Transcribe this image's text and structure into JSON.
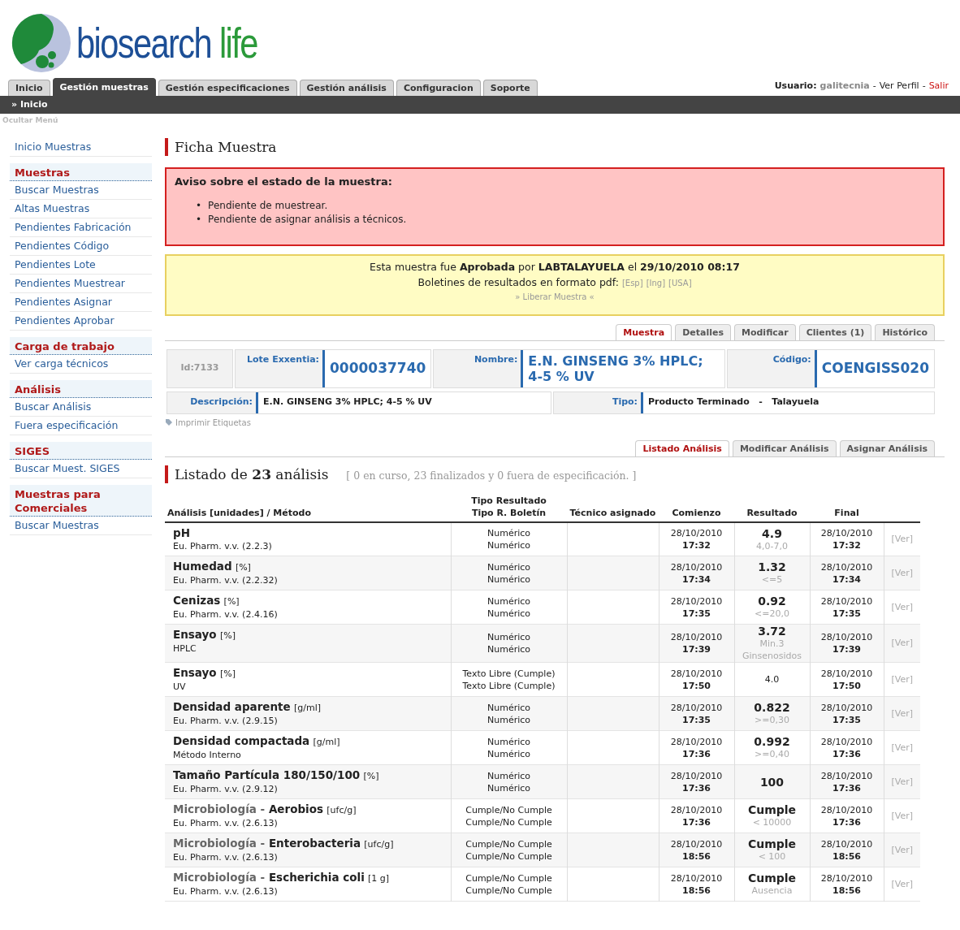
{
  "logo": {
    "word_1": "biosearch",
    "word_2": "life"
  },
  "main_tabs": [
    {
      "label": "Inicio",
      "selected": false
    },
    {
      "label": "Gestión muestras",
      "selected": true
    },
    {
      "label": "Gestión especificaciones",
      "selected": false
    },
    {
      "label": "Gestión análisis",
      "selected": false
    },
    {
      "label": "Configuracion",
      "selected": false
    },
    {
      "label": "Soporte",
      "selected": false
    }
  ],
  "user_bar": {
    "label": "Usuario:",
    "user": "galitecnia",
    "separator_1": "-",
    "profile": "Ver Perfil",
    "separator_2": "-",
    "logout": "Salir"
  },
  "breadcrumb": "» Inicio",
  "hide_menu": "Ocultar Menú",
  "sidebar": [
    {
      "kind": "link",
      "label": "Inicio Muestras"
    },
    {
      "kind": "heading",
      "label": "Muestras"
    },
    {
      "kind": "link",
      "label": "Buscar Muestras"
    },
    {
      "kind": "link",
      "label": "Altas Muestras"
    },
    {
      "kind": "link",
      "label": "Pendientes Fabricación"
    },
    {
      "kind": "link",
      "label": "Pendientes Código"
    },
    {
      "kind": "link",
      "label": "Pendientes Lote"
    },
    {
      "kind": "link",
      "label": "Pendientes Muestrear"
    },
    {
      "kind": "link",
      "label": "Pendientes Asignar"
    },
    {
      "kind": "link",
      "label": "Pendientes Aprobar"
    },
    {
      "kind": "heading",
      "label": "Carga de trabajo"
    },
    {
      "kind": "link",
      "label": "Ver carga técnicos"
    },
    {
      "kind": "heading",
      "label": "Análisis"
    },
    {
      "kind": "link",
      "label": "Buscar Análisis"
    },
    {
      "kind": "link",
      "label": "Fuera especificación"
    },
    {
      "kind": "heading",
      "label": "SIGES"
    },
    {
      "kind": "link",
      "label": "Buscar Muest. SIGES"
    },
    {
      "kind": "heading",
      "label": "Muestras para Comerciales"
    },
    {
      "kind": "link",
      "label": "Buscar Muestras"
    }
  ],
  "page_title": "Ficha Muestra",
  "warning": {
    "title": "Aviso sobre el estado de la muestra:",
    "bullet": "•",
    "items": [
      "Pendiente de muestrear.",
      "Pendiente de asignar análisis a técnicos."
    ]
  },
  "approval": {
    "text": "Esta muestra fue **Aprobada** por **LABTALAYUELA** el **29/10/2010 08:17**",
    "reports_label": "Boletines de resultados en formato pdf:",
    "reports": [
      "[Esp]",
      "[Ing]",
      "[USA]"
    ],
    "release": "» Liberar Muestra «"
  },
  "sample_tabs": [
    {
      "label": "Muestra",
      "selected": true
    },
    {
      "label": "Detalles",
      "selected": false
    },
    {
      "label": "Modificar",
      "selected": false
    },
    {
      "label": "Clientes (1)",
      "selected": false
    },
    {
      "label": "Histórico",
      "selected": false
    }
  ],
  "sample": {
    "id": "Id:7133",
    "lot_label": "Lote Exxentia:",
    "lot": "0000037740",
    "name_label": "Nombre:",
    "name": "E.N. GINSENG 3% HPLC; 4-5 % UV",
    "code_label": "Código:",
    "code": "COENGISS020",
    "description_label": "Descripción:",
    "description": "E.N. GINSENG 3% HPLC; 4-5 % UV",
    "type_label": "Tipo:",
    "type": "Producto Terminado   -   Talayuela"
  },
  "print_labels": "Imprimir Etiquetas",
  "analysis_tabs": [
    {
      "label": "Listado Análisis",
      "selected": true
    },
    {
      "label": "Modificar Análisis",
      "selected": false
    },
    {
      "label": "Asignar Análisis",
      "selected": false
    }
  ],
  "list_title": "Listado de **23** análisis",
  "list_summary": "[ 0 en curso, 23 finalizados y 0 fuera de especificación. ]",
  "table": {
    "columns": [
      "Análisis [unidades] / Método",
      "Tipo Resultado\nTipo R. Boletín",
      "Técnico asignado",
      "Comienzo",
      "Resultado",
      "Final"
    ],
    "rows": [
      {
        "prefix": "",
        "name": "pH",
        "unit": "",
        "method": "Eu. Pharm. v.v. (2.2.3)",
        "type_1": "Numérico",
        "type_2": "Numérico",
        "start_date": "28/10/2010",
        "start_time": "17:32",
        "result": "4.9",
        "result_bold": true,
        "spec": "4,0-7,0",
        "end_date": "28/10/2010",
        "end_time": "17:32",
        "link": "[Ver]"
      },
      {
        "prefix": "",
        "name": "Humedad",
        "unit": "[%]",
        "method": "Eu. Pharm. v.v. (2.2.32)",
        "type_1": "Numérico",
        "type_2": "Numérico",
        "start_date": "28/10/2010",
        "start_time": "17:34",
        "result": "1.32",
        "result_bold": true,
        "spec": "<=5",
        "end_date": "28/10/2010",
        "end_time": "17:34",
        "link": "[Ver]"
      },
      {
        "prefix": "",
        "name": "Cenizas",
        "unit": "[%]",
        "method": "Eu. Pharm. v.v. (2.4.16)",
        "type_1": "Numérico",
        "type_2": "Numérico",
        "start_date": "28/10/2010",
        "start_time": "17:35",
        "result": "0.92",
        "result_bold": true,
        "spec": "<=20,0",
        "end_date": "28/10/2010",
        "end_time": "17:35",
        "link": "[Ver]"
      },
      {
        "prefix": "",
        "name": "Ensayo",
        "unit": "[%]",
        "method": "HPLC",
        "type_1": "Numérico",
        "type_2": "Numérico",
        "start_date": "28/10/2010",
        "start_time": "17:39",
        "result": "3.72",
        "result_bold": true,
        "spec": "Min.3 Ginsenosidos",
        "end_date": "28/10/2010",
        "end_time": "17:39",
        "link": "[Ver]"
      },
      {
        "prefix": "",
        "name": "Ensayo",
        "unit": "[%]",
        "method": "UV",
        "type_1": "Texto Libre (Cumple)",
        "type_2": "Texto Libre (Cumple)",
        "start_date": "28/10/2010",
        "start_time": "17:50",
        "result": "4.0",
        "result_bold": false,
        "spec": "",
        "end_date": "28/10/2010",
        "end_time": "17:50",
        "link": "[Ver]"
      },
      {
        "prefix": "",
        "name": "Densidad aparente",
        "unit": "[g/ml]",
        "method": "Eu. Pharm. v.v. (2.9.15)",
        "type_1": "Numérico",
        "type_2": "Numérico",
        "start_date": "28/10/2010",
        "start_time": "17:35",
        "result": "0.822",
        "result_bold": true,
        "spec": ">=0,30",
        "end_date": "28/10/2010",
        "end_time": "17:35",
        "link": "[Ver]"
      },
      {
        "prefix": "",
        "name": "Densidad compactada",
        "unit": "[g/ml]",
        "method": "Método Interno",
        "type_1": "Numérico",
        "type_2": "Numérico",
        "start_date": "28/10/2010",
        "start_time": "17:36",
        "result": "0.992",
        "result_bold": true,
        "spec": ">=0,40",
        "end_date": "28/10/2010",
        "end_time": "17:36",
        "link": "[Ver]"
      },
      {
        "prefix": "",
        "name": "Tamaño Partícula 180/150/100",
        "unit": "[%]",
        "method": "Eu. Pharm. v.v. (2.9.12)",
        "type_1": "Numérico",
        "type_2": "Numérico",
        "start_date": "28/10/2010",
        "start_time": "17:36",
        "result": "100",
        "result_bold": true,
        "spec": "",
        "end_date": "28/10/2010",
        "end_time": "17:36",
        "link": "[Ver]"
      },
      {
        "prefix": "Microbiología -",
        "name": "Aerobios",
        "unit": "[ufc/g]",
        "method": "Eu. Pharm. v.v. (2.6.13)",
        "type_1": "Cumple/No Cumple",
        "type_2": "Cumple/No Cumple",
        "start_date": "28/10/2010",
        "start_time": "17:36",
        "result": "Cumple",
        "result_bold": true,
        "spec": "< 10000",
        "end_date": "28/10/2010",
        "end_time": "17:36",
        "link": "[Ver]"
      },
      {
        "prefix": "Microbiología -",
        "name": "Enterobacteria",
        "unit": "[ufc/g]",
        "method": "Eu. Pharm. v.v. (2.6.13)",
        "type_1": "Cumple/No Cumple",
        "type_2": "Cumple/No Cumple",
        "start_date": "28/10/2010",
        "start_time": "18:56",
        "result": "Cumple",
        "result_bold": true,
        "spec": "< 100",
        "end_date": "28/10/2010",
        "end_time": "18:56",
        "link": "[Ver]"
      },
      {
        "prefix": "Microbiología -",
        "name": "Escherichia coli",
        "unit": "[1 g]",
        "method": "Eu. Pharm. v.v. (2.6.13)",
        "type_1": "Cumple/No Cumple",
        "type_2": "Cumple/No Cumple",
        "start_date": "28/10/2010",
        "start_time": "18:56",
        "result": "Cumple",
        "result_bold": true,
        "spec": "Ausencia",
        "end_date": "28/10/2010",
        "end_time": "18:56",
        "link": "[Ver]"
      }
    ]
  }
}
